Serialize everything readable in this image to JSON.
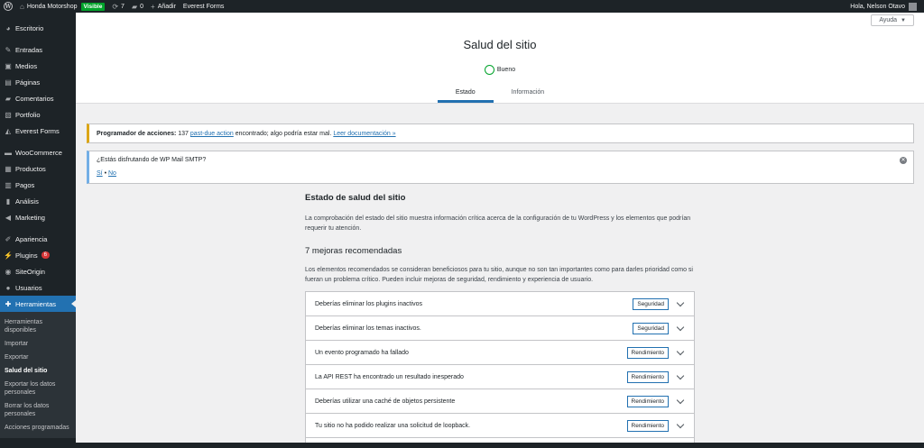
{
  "admin_bar": {
    "site_name": "Honda Motorshop",
    "visibility_badge": "Visible",
    "updates_count": "7",
    "comments_count": "0",
    "add_new": "Añadir",
    "everest_forms": "Everest Forms",
    "greeting": "Hola, Nelson Otavo"
  },
  "sidebar": {
    "items": [
      {
        "label": "Escritorio",
        "icon": "dashboard-icon"
      },
      {
        "label": "Entradas",
        "icon": "pin-icon"
      },
      {
        "label": "Medios",
        "icon": "media-icon"
      },
      {
        "label": "Páginas",
        "icon": "page-icon"
      },
      {
        "label": "Comentarios",
        "icon": "comment-icon"
      },
      {
        "label": "Portfolio",
        "icon": "portfolio-icon"
      },
      {
        "label": "Everest Forms",
        "icon": "forms-icon"
      },
      {
        "label": "WooCommerce",
        "icon": "woo-icon"
      },
      {
        "label": "Productos",
        "icon": "archive-icon"
      },
      {
        "label": "Pagos",
        "icon": "payments-icon"
      },
      {
        "label": "Análisis",
        "icon": "chart-icon"
      },
      {
        "label": "Marketing",
        "icon": "megaphone-icon"
      },
      {
        "label": "Apariencia",
        "icon": "brush-icon"
      },
      {
        "label": "Plugins",
        "icon": "plugin-icon",
        "badge": "6"
      },
      {
        "label": "SiteOrigin",
        "icon": "siteorigin-icon"
      },
      {
        "label": "Usuarios",
        "icon": "users-icon"
      },
      {
        "label": "Herramientas",
        "icon": "wrench-icon"
      }
    ],
    "submenu": [
      "Herramientas disponibles",
      "Importar",
      "Exportar",
      "Salud del sitio",
      "Exportar los datos personales",
      "Borrar los datos personales",
      "Acciones programadas"
    ]
  },
  "help_button": "Ayuda",
  "header": {
    "title": "Salud del sitio",
    "status": "Bueno",
    "tabs": [
      "Estado",
      "Información"
    ]
  },
  "notices": {
    "warning": {
      "bold": "Programador de acciones:",
      "text1": "137",
      "link1": "past-due action",
      "text2": "encontrado; algo podría estar mal.",
      "link2": "Leer documentación »"
    },
    "info": {
      "text": "¿Estás disfrutando de WP Mail SMTP?",
      "yes": "Sí",
      "separator": "•",
      "no": "No"
    }
  },
  "main": {
    "title": "Estado de salud del sitio",
    "description": "La comprobación del estado del sitio muestra información crítica acerca de la configuración de tu WordPress y los elementos que podrían requerir tu atención.",
    "recommended_title": "7 mejoras recomendadas",
    "recommended_desc": "Los elementos recomendados se consideran beneficiosos para tu sitio, aunque no son tan importantes como para darles prioridad como si fueran un problema crítico. Pueden incluir mejoras de seguridad, rendimiento y experiencia de usuario.",
    "items": [
      {
        "label": "Deberías eliminar los plugins inactivos",
        "tag": "Seguridad"
      },
      {
        "label": "Deberías eliminar los temas inactivos.",
        "tag": "Seguridad"
      },
      {
        "label": "Un evento programado ha fallado",
        "tag": "Rendimiento"
      },
      {
        "label": "La API REST ha encontrado un resultado inesperado",
        "tag": "Rendimiento"
      },
      {
        "label": "Deberías utilizar una caché de objetos persistente",
        "tag": "Rendimiento"
      },
      {
        "label": "Tu sitio no ha podido realizar una solicitud de loopback.",
        "tag": "Rendimiento"
      }
    ]
  }
}
